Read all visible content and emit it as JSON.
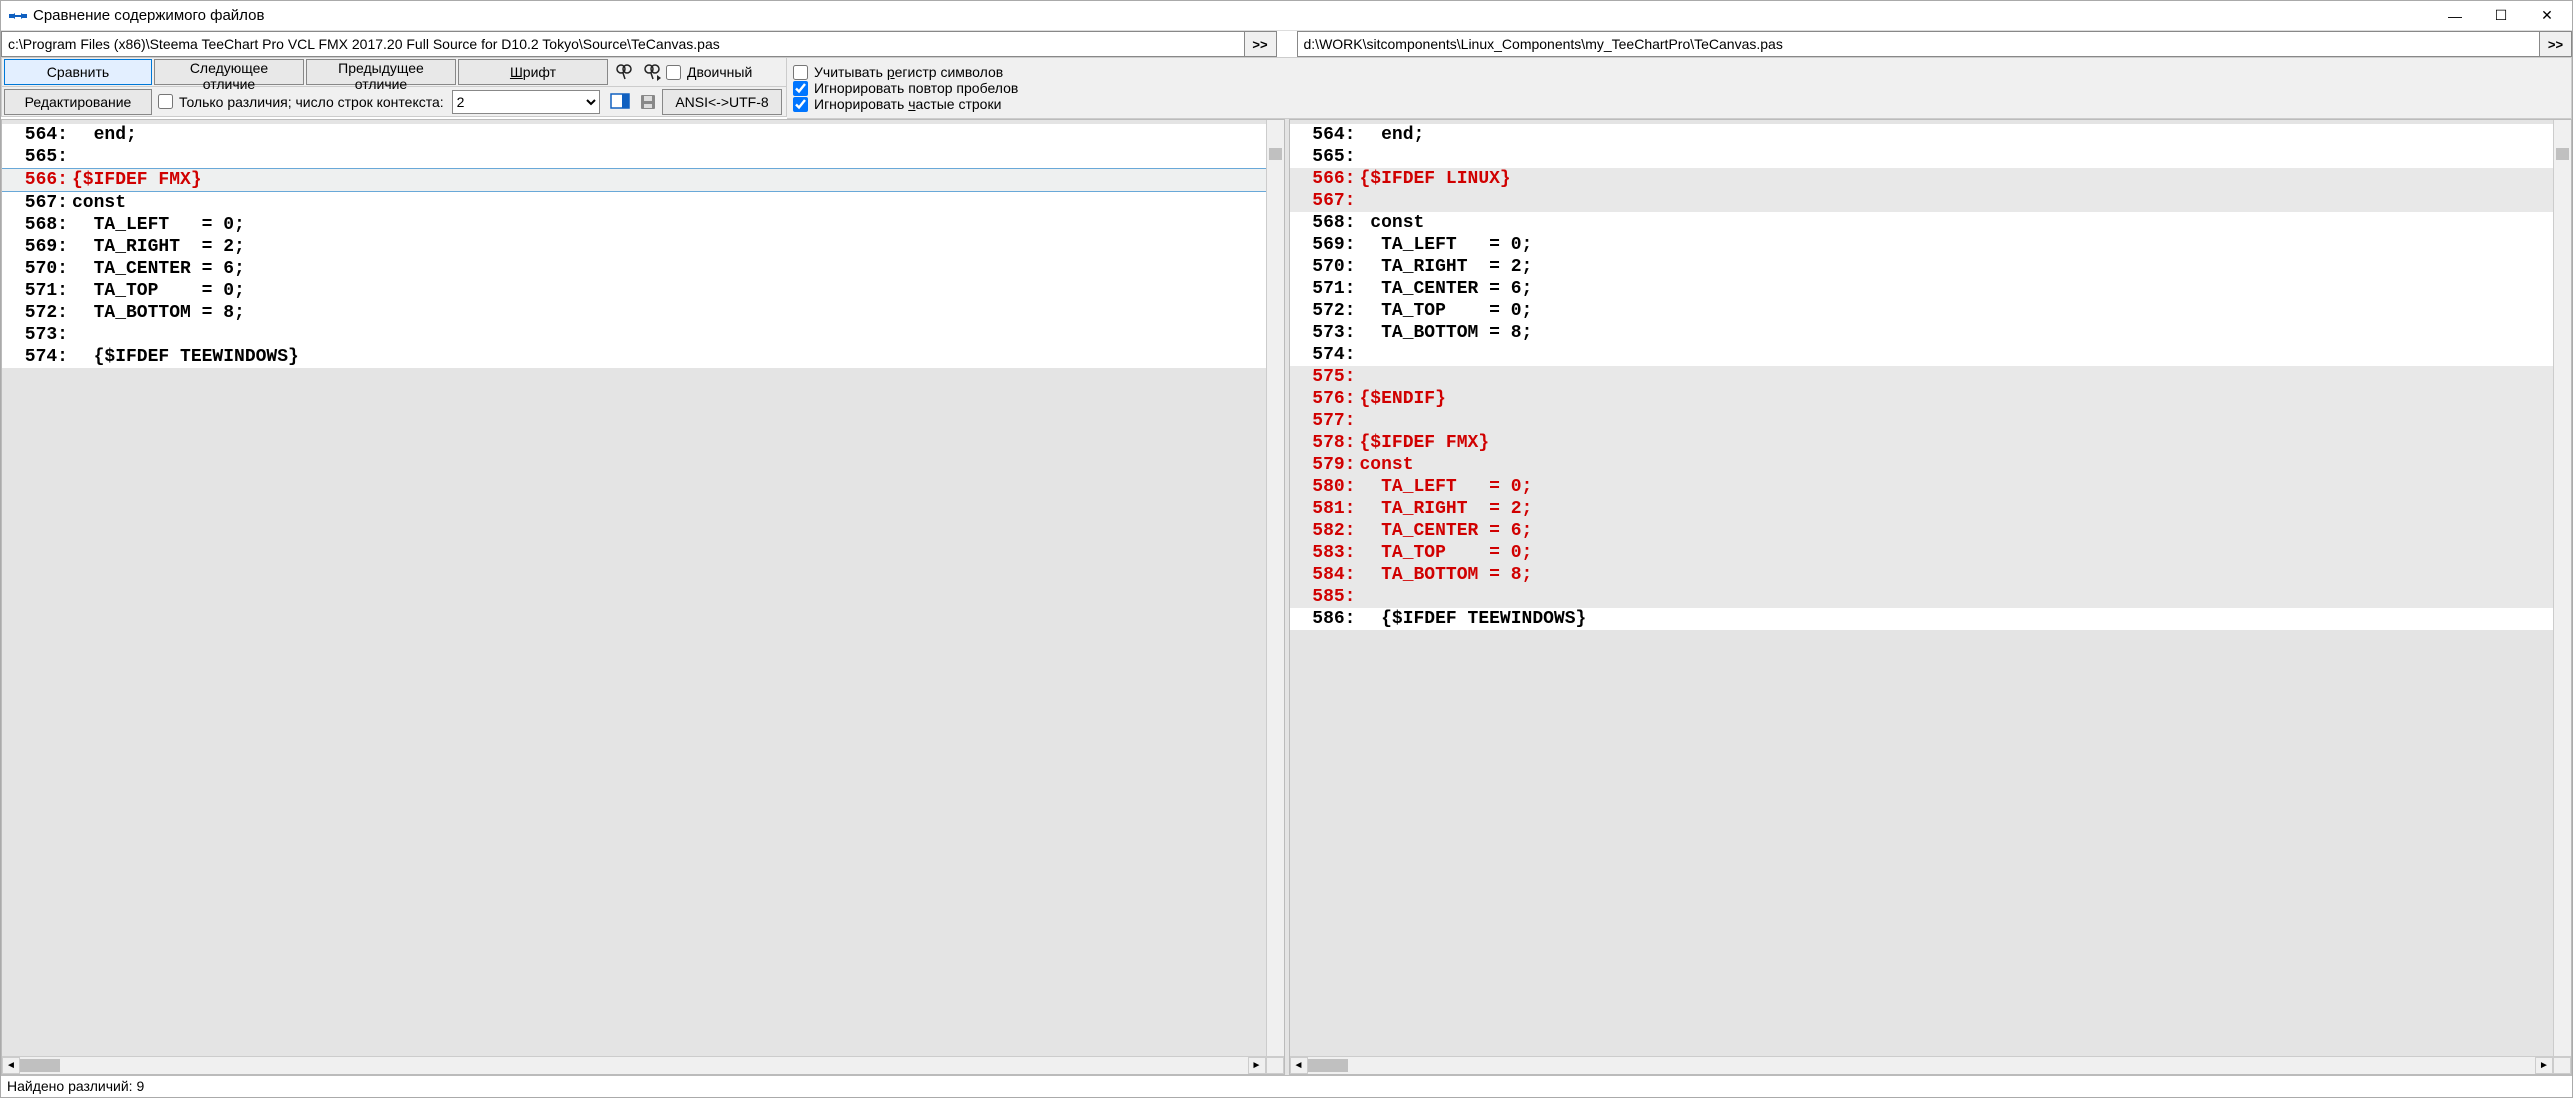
{
  "window": {
    "title": "Сравнение содержимого файлов",
    "minimize": "—",
    "maximize": "☐",
    "close": "✕"
  },
  "paths": {
    "left": "c:\\Program Files (x86)\\Steema TeeChart Pro VCL FMX 2017.20 Full Source for D10.2 Tokyo\\Source\\TeCanvas.pas",
    "right": "d:\\WORK\\sitcomponents\\Linux_Components\\my_TeeChartPro\\TeCanvas.pas",
    "go": ">>"
  },
  "toolbar": {
    "compare": "Сравнить",
    "next_diff": "Следующее отличие",
    "prev_diff": "Предыдущее отличие",
    "font": "Шрифт",
    "binary": "Двоичный",
    "edit": "Редактирование",
    "only_diffs_label": "Только различия; число строк контекста:",
    "context_lines": "2",
    "encoding": "ANSI<->UTF-8"
  },
  "options": {
    "case_sensitive_label": "Учитывать регистр символов",
    "case_sensitive": false,
    "ignore_repeated_spaces_label": "Игнорировать повтор пробелов",
    "ignore_repeated_spaces": true,
    "ignore_frequent_lines_label": "Игнорировать частые строки",
    "ignore_frequent_lines": true
  },
  "left_lines": [
    {
      "n": "564:",
      "t": "  end;",
      "cls": "row-white",
      "col": "txt-black"
    },
    {
      "n": "565:",
      "t": "",
      "cls": "row-white",
      "col": "txt-black"
    },
    {
      "n": "566:",
      "t": "{$IFDEF FMX}",
      "cls": "row-selected",
      "col": "txt-red"
    },
    {
      "n": "567:",
      "t": "const",
      "cls": "row-white",
      "col": "txt-black"
    },
    {
      "n": "568:",
      "t": "  TA_LEFT   = 0;",
      "cls": "row-white",
      "col": "txt-black"
    },
    {
      "n": "569:",
      "t": "  TA_RIGHT  = 2;",
      "cls": "row-white",
      "col": "txt-black"
    },
    {
      "n": "570:",
      "t": "  TA_CENTER = 6;",
      "cls": "row-white",
      "col": "txt-black"
    },
    {
      "n": "571:",
      "t": "  TA_TOP    = 0;",
      "cls": "row-white",
      "col": "txt-black"
    },
    {
      "n": "572:",
      "t": "  TA_BOTTOM = 8;",
      "cls": "row-white",
      "col": "txt-black"
    },
    {
      "n": "573:",
      "t": "",
      "cls": "row-white",
      "col": "txt-black"
    },
    {
      "n": "",
      "t": "",
      "cls": "row-grey",
      "col": "txt-black"
    },
    {
      "n": "",
      "t": "",
      "cls": "row-grey",
      "col": "txt-black"
    },
    {
      "n": "",
      "t": "",
      "cls": "row-grey",
      "col": "txt-black"
    },
    {
      "n": "",
      "t": "",
      "cls": "row-grey",
      "col": "txt-black"
    },
    {
      "n": "",
      "t": "",
      "cls": "row-grey",
      "col": "txt-black"
    },
    {
      "n": "",
      "t": "",
      "cls": "row-grey",
      "col": "txt-black"
    },
    {
      "n": "",
      "t": "",
      "cls": "row-grey",
      "col": "txt-black"
    },
    {
      "n": "",
      "t": "",
      "cls": "row-grey",
      "col": "txt-black"
    },
    {
      "n": "",
      "t": "",
      "cls": "row-grey",
      "col": "txt-black"
    },
    {
      "n": "",
      "t": "",
      "cls": "row-grey",
      "col": "txt-black"
    },
    {
      "n": "",
      "t": "",
      "cls": "row-grey",
      "col": "txt-black"
    },
    {
      "n": "",
      "t": "",
      "cls": "row-grey",
      "col": "txt-black"
    },
    {
      "n": "574:",
      "t": "  {$IFDEF TEEWINDOWS}",
      "cls": "row-white",
      "col": "txt-black"
    }
  ],
  "right_lines": [
    {
      "n": "564:",
      "t": "  end;",
      "cls": "row-white",
      "col": "txt-black"
    },
    {
      "n": "565:",
      "t": "",
      "cls": "row-white",
      "col": "txt-black"
    },
    {
      "n": "566:",
      "t": "{$IFDEF LINUX}",
      "cls": "row-grey",
      "col": "txt-red"
    },
    {
      "n": "567:",
      "t": "",
      "cls": "row-grey",
      "col": "txt-red"
    },
    {
      "n": "568:",
      "t": " const",
      "cls": "row-white",
      "col": "txt-black"
    },
    {
      "n": "569:",
      "t": "  TA_LEFT   = 0;",
      "cls": "row-white",
      "col": "txt-black"
    },
    {
      "n": "570:",
      "t": "  TA_RIGHT  = 2;",
      "cls": "row-white",
      "col": "txt-black"
    },
    {
      "n": "571:",
      "t": "  TA_CENTER = 6;",
      "cls": "row-white",
      "col": "txt-black"
    },
    {
      "n": "572:",
      "t": "  TA_TOP    = 0;",
      "cls": "row-white",
      "col": "txt-black"
    },
    {
      "n": "573:",
      "t": "  TA_BOTTOM = 8;",
      "cls": "row-white",
      "col": "txt-black"
    },
    {
      "n": "574:",
      "t": "",
      "cls": "row-white",
      "col": "txt-black"
    },
    {
      "n": "575:",
      "t": "",
      "cls": "row-grey",
      "col": "txt-red"
    },
    {
      "n": "576:",
      "t": "{$ENDIF}",
      "cls": "row-grey",
      "col": "txt-red"
    },
    {
      "n": "577:",
      "t": "",
      "cls": "row-grey",
      "col": "txt-red"
    },
    {
      "n": "578:",
      "t": "{$IFDEF FMX}",
      "cls": "row-grey",
      "col": "txt-red"
    },
    {
      "n": "579:",
      "t": "const",
      "cls": "row-grey",
      "col": "txt-red"
    },
    {
      "n": "580:",
      "t": "  TA_LEFT   = 0;",
      "cls": "row-grey",
      "col": "txt-red"
    },
    {
      "n": "581:",
      "t": "  TA_RIGHT  = 2;",
      "cls": "row-grey",
      "col": "txt-red"
    },
    {
      "n": "582:",
      "t": "  TA_CENTER = 6;",
      "cls": "row-grey",
      "col": "txt-red"
    },
    {
      "n": "583:",
      "t": "  TA_TOP    = 0;",
      "cls": "row-grey",
      "col": "txt-red"
    },
    {
      "n": "584:",
      "t": "  TA_BOTTOM = 8;",
      "cls": "row-grey",
      "col": "txt-red"
    },
    {
      "n": "585:",
      "t": "",
      "cls": "row-grey",
      "col": "txt-red"
    },
    {
      "n": "586:",
      "t": "  {$IFDEF TEEWINDOWS}",
      "cls": "row-white",
      "col": "txt-black"
    }
  ],
  "status": "Найдено различий: 9"
}
